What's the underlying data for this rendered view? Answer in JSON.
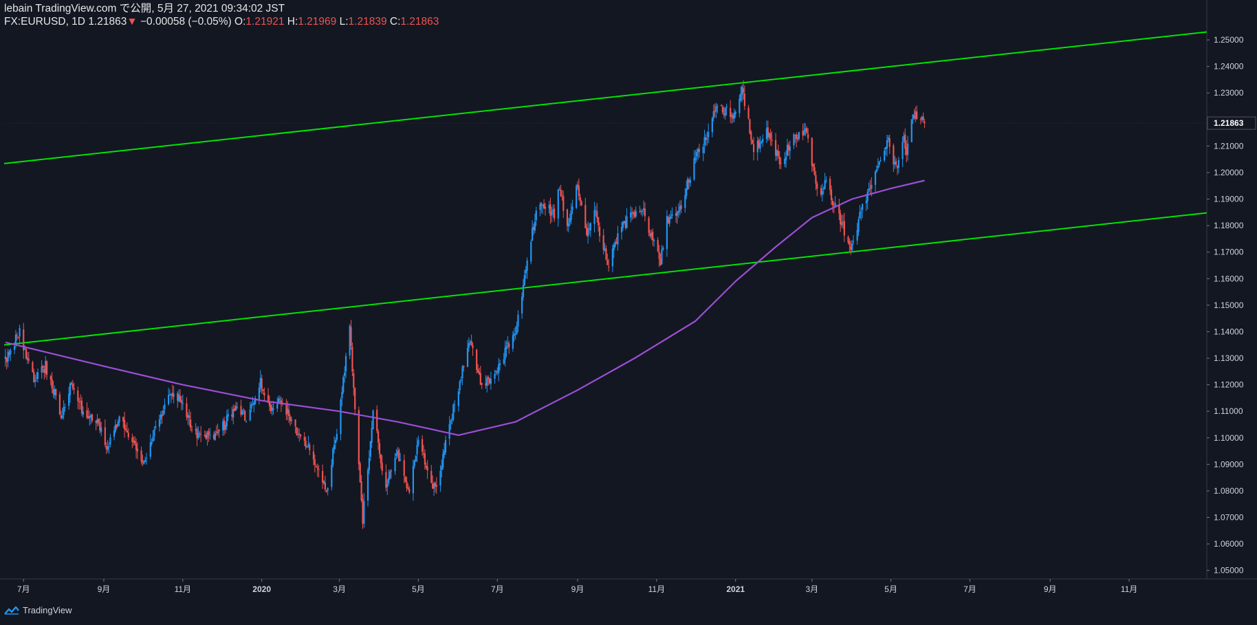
{
  "header": {
    "publish_line": "lebain TradingView.com で公開, 5月 27, 2021 09:34:02 JST",
    "symbol": "FX:EURUSD, 1D",
    "last": "1.21863",
    "change_arrow": "▼",
    "change": "−0.00058 (−0.05%)",
    "open_label": "O:",
    "open": "1.21921",
    "high_label": "H:",
    "high": "1.21969",
    "low_label": "L:",
    "low": "1.21839",
    "close_label": "C:",
    "close": "1.21863"
  },
  "footer": {
    "brand": "TradingView"
  },
  "colors": {
    "background": "#131722",
    "up": "#2196f3",
    "down": "#ef5350",
    "channel": "#00e600",
    "ma": "#9c4fd6",
    "axis_text": "#d1d4dc",
    "price_label_bg": "#131722"
  },
  "chart_data": {
    "type": "candlestick",
    "symbol": "FX:EURUSD",
    "interval": "1D",
    "xlim": [
      "2019-06-16",
      "2021-12-31"
    ],
    "ylim": [
      1.0468,
      1.2552
    ],
    "x_ticks": [
      {
        "date": "2019-07-01",
        "label": "7月"
      },
      {
        "date": "2019-09-01",
        "label": "9月"
      },
      {
        "date": "2019-11-01",
        "label": "11月"
      },
      {
        "date": "2020-01-01",
        "label": "2020"
      },
      {
        "date": "2020-03-01",
        "label": "3月"
      },
      {
        "date": "2020-05-01",
        "label": "5月"
      },
      {
        "date": "2020-07-01",
        "label": "7月"
      },
      {
        "date": "2020-09-01",
        "label": "9月"
      },
      {
        "date": "2020-11-01",
        "label": "11月"
      },
      {
        "date": "2021-01-01",
        "label": "2021"
      },
      {
        "date": "2021-03-01",
        "label": "3月"
      },
      {
        "date": "2021-05-01",
        "label": "5月"
      },
      {
        "date": "2021-07-01",
        "label": "7月"
      },
      {
        "date": "2021-09-01",
        "label": "9月"
      },
      {
        "date": "2021-11-01",
        "label": "11月"
      }
    ],
    "y_ticks": [
      "1.05000",
      "1.06000",
      "1.07000",
      "1.08000",
      "1.09000",
      "1.10000",
      "1.11000",
      "1.12000",
      "1.13000",
      "1.14000",
      "1.15000",
      "1.16000",
      "1.17000",
      "1.18000",
      "1.19000",
      "1.20000",
      "1.21000",
      "1.22000",
      "1.23000",
      "1.24000",
      "1.25000"
    ],
    "last_price": 1.21863,
    "last_price_label": "1.21863",
    "close_path": [
      [
        "2019-06-17",
        1.129
      ],
      [
        "2019-06-25",
        1.137
      ],
      [
        "2019-06-28",
        1.14
      ],
      [
        "2019-07-09",
        1.121
      ],
      [
        "2019-07-18",
        1.127
      ],
      [
        "2019-07-31",
        1.108
      ],
      [
        "2019-08-06",
        1.12
      ],
      [
        "2019-08-15",
        1.111
      ],
      [
        "2019-08-28",
        1.106
      ],
      [
        "2019-09-03",
        1.096
      ],
      [
        "2019-09-13",
        1.107
      ],
      [
        "2019-09-20",
        1.102
      ],
      [
        "2019-10-01",
        1.09
      ],
      [
        "2019-10-11",
        1.103
      ],
      [
        "2019-10-21",
        1.115
      ],
      [
        "2019-10-31",
        1.115
      ],
      [
        "2019-11-06",
        1.106
      ],
      [
        "2019-11-14",
        1.1
      ],
      [
        "2019-11-29",
        1.102
      ],
      [
        "2019-12-13",
        1.112
      ],
      [
        "2019-12-20",
        1.108
      ],
      [
        "2019-12-31",
        1.121
      ],
      [
        "2020-01-08",
        1.11
      ],
      [
        "2020-01-16",
        1.114
      ],
      [
        "2020-01-29",
        1.102
      ],
      [
        "2020-02-07",
        1.096
      ],
      [
        "2020-02-20",
        1.079
      ],
      [
        "2020-02-28",
        1.103
      ],
      [
        "2020-03-05",
        1.125
      ],
      [
        "2020-03-09",
        1.144
      ],
      [
        "2020-03-12",
        1.117
      ],
      [
        "2020-03-19",
        1.069
      ],
      [
        "2020-03-27",
        1.109
      ],
      [
        "2020-04-06",
        1.081
      ],
      [
        "2020-04-14",
        1.096
      ],
      [
        "2020-04-24",
        1.08
      ],
      [
        "2020-05-01",
        1.098
      ],
      [
        "2020-05-14",
        1.08
      ],
      [
        "2020-05-21",
        1.095
      ],
      [
        "2020-06-03",
        1.124
      ],
      [
        "2020-06-10",
        1.138
      ],
      [
        "2020-06-19",
        1.118
      ],
      [
        "2020-06-30",
        1.125
      ],
      [
        "2020-07-15",
        1.141
      ],
      [
        "2020-07-27",
        1.175
      ],
      [
        "2020-07-31",
        1.185
      ],
      [
        "2020-08-06",
        1.188
      ],
      [
        "2020-08-14",
        1.184
      ],
      [
        "2020-08-18",
        1.195
      ],
      [
        "2020-08-24",
        1.179
      ],
      [
        "2020-09-01",
        1.195
      ],
      [
        "2020-09-08",
        1.178
      ],
      [
        "2020-09-14",
        1.186
      ],
      [
        "2020-09-25",
        1.163
      ],
      [
        "2020-09-30",
        1.174
      ],
      [
        "2020-10-09",
        1.182
      ],
      [
        "2020-10-21",
        1.186
      ],
      [
        "2020-11-04",
        1.166
      ],
      [
        "2020-11-09",
        1.182
      ],
      [
        "2020-11-20",
        1.186
      ],
      [
        "2020-12-01",
        1.207
      ],
      [
        "2020-12-10",
        1.214
      ],
      [
        "2020-12-17",
        1.226
      ],
      [
        "2020-12-31",
        1.221
      ],
      [
        "2021-01-06",
        1.232
      ],
      [
        "2021-01-15",
        1.208
      ],
      [
        "2021-01-25",
        1.215
      ],
      [
        "2021-02-05",
        1.204
      ],
      [
        "2021-02-15",
        1.213
      ],
      [
        "2021-02-25",
        1.217
      ],
      [
        "2021-03-05",
        1.192
      ],
      [
        "2021-03-12",
        1.196
      ],
      [
        "2021-03-23",
        1.182
      ],
      [
        "2021-03-31",
        1.172
      ],
      [
        "2021-04-12",
        1.191
      ],
      [
        "2021-04-22",
        1.203
      ],
      [
        "2021-04-29",
        1.212
      ],
      [
        "2021-05-05",
        1.201
      ],
      [
        "2021-05-11",
        1.215
      ],
      [
        "2021-05-13",
        1.207
      ],
      [
        "2021-05-18",
        1.222
      ],
      [
        "2021-05-24",
        1.221
      ],
      [
        "2021-05-27",
        1.2186
      ]
    ],
    "ma_path": [
      [
        "2019-06-17",
        1.136
      ],
      [
        "2019-09-01",
        1.127
      ],
      [
        "2019-11-01",
        1.12
      ],
      [
        "2020-01-01",
        1.114
      ],
      [
        "2020-03-01",
        1.11
      ],
      [
        "2020-04-15",
        1.106
      ],
      [
        "2020-06-01",
        1.101
      ],
      [
        "2020-07-15",
        1.106
      ],
      [
        "2020-09-01",
        1.118
      ],
      [
        "2020-10-15",
        1.13
      ],
      [
        "2020-12-01",
        1.144
      ],
      [
        "2021-01-01",
        1.159
      ],
      [
        "2021-02-01",
        1.172
      ],
      [
        "2021-03-01",
        1.183
      ],
      [
        "2021-04-01",
        1.19
      ],
      [
        "2021-05-01",
        1.194
      ],
      [
        "2021-05-27",
        1.197
      ]
    ],
    "trendlines": [
      {
        "x1": "2019-06-16",
        "y1": 1.2034,
        "x2": "2021-12-31",
        "y2": 1.253
      },
      {
        "x1": "2019-06-16",
        "y1": 1.135,
        "x2": "2021-12-31",
        "y2": 1.1848
      }
    ]
  }
}
